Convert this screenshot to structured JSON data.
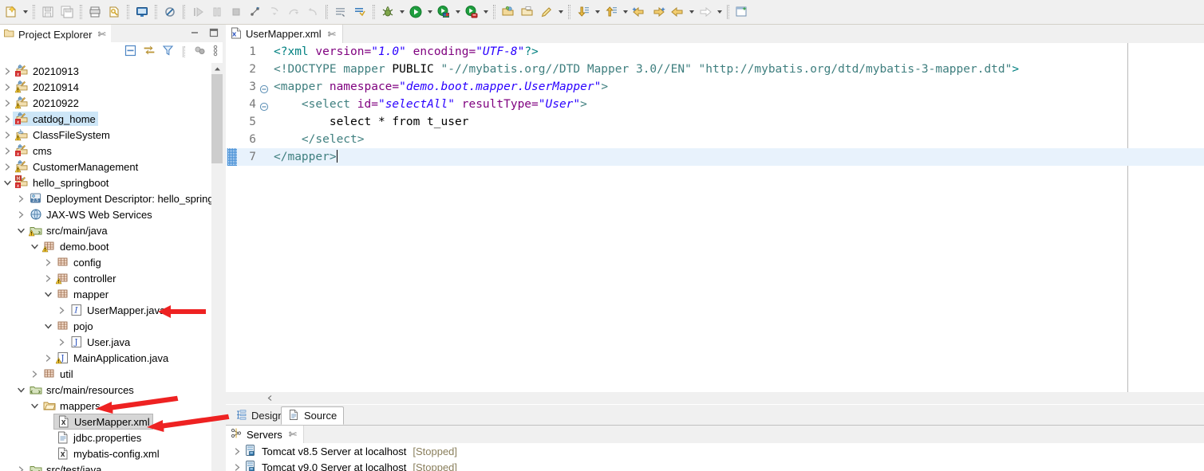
{
  "toolbar": {
    "items": [
      {
        "name": "new-wizard-icon",
        "label": "New",
        "has_dropdown": true
      },
      {
        "name": "save-icon",
        "label": "Save",
        "has_dropdown": false
      },
      {
        "name": "save-all-icon",
        "label": "Save All",
        "has_dropdown": false
      },
      {
        "name": "print-icon",
        "label": "Print",
        "has_dropdown": false
      },
      {
        "name": "link-resource-icon",
        "label": "Link",
        "has_dropdown": false
      },
      {
        "name": "console-icon",
        "label": "Console",
        "has_dropdown": false
      },
      {
        "name": "no-marker-icon",
        "label": "Skip All Breakpoints",
        "has_dropdown": false
      },
      {
        "name": "resume-icon",
        "label": "Resume",
        "has_dropdown": false
      },
      {
        "name": "suspend-icon",
        "label": "Suspend",
        "has_dropdown": false
      },
      {
        "name": "terminate-icon",
        "label": "Terminate",
        "has_dropdown": false
      },
      {
        "name": "disconnect-icon",
        "label": "Disconnect",
        "has_dropdown": false
      },
      {
        "name": "step-into-icon",
        "label": "Step Into",
        "has_dropdown": false
      },
      {
        "name": "step-over-icon",
        "label": "Step Over",
        "has_dropdown": false
      },
      {
        "name": "step-return-icon",
        "label": "Step Return",
        "has_dropdown": false
      },
      {
        "name": "open-task-icon",
        "label": "Open Task",
        "has_dropdown": false
      },
      {
        "name": "new-java-class-icon",
        "label": "New Java Class",
        "has_dropdown": false
      },
      {
        "name": "debug-icon",
        "label": "Debug",
        "has_dropdown": true
      },
      {
        "name": "run-icon",
        "label": "Run",
        "has_dropdown": true
      },
      {
        "name": "run-on-server-icon",
        "label": "Run on Server",
        "has_dropdown": true
      },
      {
        "name": "profile-icon",
        "label": "Profile",
        "has_dropdown": true
      },
      {
        "name": "open-type-icon",
        "label": "Open Type",
        "has_dropdown": false
      },
      {
        "name": "open-resource-icon",
        "label": "Open Resource",
        "has_dropdown": false
      },
      {
        "name": "quick-access-icon",
        "label": "Search",
        "has_dropdown": true
      },
      {
        "name": "previous-annotation-icon",
        "label": "Previous Annotation",
        "has_dropdown": true
      },
      {
        "name": "next-annotation-icon",
        "label": "Next Annotation",
        "has_dropdown": true
      },
      {
        "name": "back-edit-icon",
        "label": "Last Edit Location",
        "has_dropdown": false
      },
      {
        "name": "forward-edit-icon",
        "label": "Next Edit Location",
        "has_dropdown": false
      },
      {
        "name": "back-icon",
        "label": "Back",
        "has_dropdown": true
      },
      {
        "name": "forward-icon",
        "label": "Forward",
        "has_dropdown": true
      },
      {
        "name": "new-window-icon",
        "label": "New Window",
        "has_dropdown": false
      }
    ]
  },
  "explorer": {
    "tab_title": "Project Explorer",
    "tab_close_glyph": "✄",
    "window_buttons": [
      {
        "name": "minimize-view-button",
        "glyph": "—"
      },
      {
        "name": "maximize-view-button",
        "glyph": "❐"
      }
    ],
    "view_toolbar": [
      {
        "name": "collapse-all-icon",
        "label": "Collapse All"
      },
      {
        "name": "link-with-editor-icon",
        "label": "Link with Editor"
      },
      {
        "name": "filter-icon",
        "label": "Filters"
      },
      {
        "name": "view-layout-icon",
        "label": "View Layout"
      },
      {
        "name": "view-menu-icon",
        "label": "View Menu"
      }
    ],
    "tree": [
      {
        "label": "20210913",
        "indent": 0,
        "twist": "collapsed",
        "icon": "web-project-error-icon",
        "selected": "none"
      },
      {
        "label": "20210914",
        "indent": 0,
        "twist": "collapsed",
        "icon": "web-project-warning-icon",
        "selected": "none"
      },
      {
        "label": "20210922",
        "indent": 0,
        "twist": "collapsed",
        "icon": "web-project-warning-icon",
        "selected": "none"
      },
      {
        "label": "catdog_home",
        "indent": 0,
        "twist": "collapsed",
        "icon": "web-project-error-icon",
        "selected": "blue"
      },
      {
        "label": "ClassFileSystem",
        "indent": 0,
        "twist": "collapsed",
        "icon": "java-project-warning-icon",
        "selected": "none"
      },
      {
        "label": "cms",
        "indent": 0,
        "twist": "collapsed",
        "icon": "web-project-error-icon",
        "selected": "none"
      },
      {
        "label": "CustomerManagement",
        "indent": 0,
        "twist": "collapsed",
        "icon": "web-project-warning-icon",
        "selected": "none"
      },
      {
        "label": "hello_springboot",
        "indent": 0,
        "twist": "expanded",
        "icon": "maven-project-error-icon",
        "selected": "none"
      },
      {
        "label": "Deployment Descriptor: hello_springb",
        "indent": 1,
        "twist": "collapsed",
        "icon": "deployment-descriptor-icon",
        "selected": "none"
      },
      {
        "label": "JAX-WS Web Services",
        "indent": 1,
        "twist": "collapsed",
        "icon": "jaxws-icon",
        "selected": "none"
      },
      {
        "label": "src/main/java",
        "indent": 1,
        "twist": "expanded",
        "icon": "source-folder-warning-icon",
        "selected": "none"
      },
      {
        "label": "demo.boot",
        "indent": 2,
        "twist": "expanded",
        "icon": "package-warning-icon",
        "selected": "none"
      },
      {
        "label": "config",
        "indent": 3,
        "twist": "collapsed",
        "icon": "package-icon",
        "selected": "none"
      },
      {
        "label": "controller",
        "indent": 3,
        "twist": "collapsed",
        "icon": "package-warning-icon",
        "selected": "none"
      },
      {
        "label": "mapper",
        "indent": 3,
        "twist": "expanded",
        "icon": "package-icon",
        "selected": "none"
      },
      {
        "label": "UserMapper.java",
        "indent": 4,
        "twist": "collapsed",
        "icon": "java-interface-icon",
        "selected": "none"
      },
      {
        "label": "pojo",
        "indent": 3,
        "twist": "expanded",
        "icon": "package-icon",
        "selected": "none"
      },
      {
        "label": "User.java",
        "indent": 4,
        "twist": "collapsed",
        "icon": "java-class-icon",
        "selected": "none"
      },
      {
        "label": "MainApplication.java",
        "indent": 3,
        "twist": "collapsed",
        "icon": "java-class-warning-icon",
        "selected": "none"
      },
      {
        "label": "util",
        "indent": 2,
        "twist": "collapsed",
        "icon": "package-icon",
        "selected": "none"
      },
      {
        "label": "src/main/resources",
        "indent": 1,
        "twist": "expanded",
        "icon": "source-folder-icon",
        "selected": "none"
      },
      {
        "label": "mappers",
        "indent": 2,
        "twist": "expanded",
        "icon": "folder-icon",
        "selected": "none"
      },
      {
        "label": "UserMapper.xml",
        "indent": 3,
        "twist": "none",
        "icon": "xml-file-icon",
        "selected": "gray"
      },
      {
        "label": "jdbc.properties",
        "indent": 3,
        "twist": "none",
        "icon": "properties-file-icon",
        "selected": "none"
      },
      {
        "label": "mybatis-config.xml",
        "indent": 3,
        "twist": "none",
        "icon": "xml-file-icon",
        "selected": "none"
      },
      {
        "label": "src/test/java",
        "indent": 1,
        "twist": "collapsed",
        "icon": "source-folder-icon",
        "selected": "none"
      }
    ]
  },
  "editor": {
    "tab": {
      "title": "UserMapper.xml",
      "icon": "xml-file-icon",
      "close_glyph": "✄"
    },
    "print_margin_x": 1130,
    "current_line": 7,
    "lines": [
      {
        "num": "1",
        "fold": "none",
        "changed": false,
        "current": false,
        "tokens": [
          {
            "t": "<?xml ",
            "c": "x-punct"
          },
          {
            "t": "version=",
            "c": "x-attr"
          },
          {
            "t": "\"1.0\"",
            "c": "x-val"
          },
          {
            "t": " ",
            "c": "x-plain"
          },
          {
            "t": "encoding=",
            "c": "x-attr"
          },
          {
            "t": "\"UTF-8\"",
            "c": "x-val"
          },
          {
            "t": "?>",
            "c": "x-punct"
          }
        ]
      },
      {
        "num": "2",
        "fold": "none",
        "changed": false,
        "current": false,
        "tokens": [
          {
            "t": "<!DOCTYPE mapper ",
            "c": "x-doctype"
          },
          {
            "t": "PUBLIC",
            "c": "x-plain"
          },
          {
            "t": " \"-//mybatis.org//DTD Mapper 3.0//EN\" \"http://mybatis.org/dtd/mybatis-3-mapper.dtd\"",
            "c": "x-dtdstr"
          },
          {
            "t": ">",
            "c": "x-punct"
          }
        ]
      },
      {
        "num": "3",
        "fold": "collapse",
        "changed": false,
        "current": false,
        "tokens": [
          {
            "t": "<mapper ",
            "c": "x-tag"
          },
          {
            "t": "namespace=",
            "c": "x-attr"
          },
          {
            "t": "\"demo.boot.mapper.UserMapper\"",
            "c": "x-val"
          },
          {
            "t": ">",
            "c": "x-tag"
          }
        ]
      },
      {
        "num": "4",
        "fold": "collapse",
        "changed": false,
        "current": false,
        "tokens": [
          {
            "t": "    <select ",
            "c": "x-tag"
          },
          {
            "t": "id=",
            "c": "x-attr"
          },
          {
            "t": "\"selectAll\"",
            "c": "x-val"
          },
          {
            "t": " ",
            "c": "x-plain"
          },
          {
            "t": "resultType=",
            "c": "x-attr"
          },
          {
            "t": "\"User\"",
            "c": "x-val"
          },
          {
            "t": ">",
            "c": "x-tag"
          }
        ]
      },
      {
        "num": "5",
        "fold": "none",
        "changed": false,
        "current": false,
        "tokens": [
          {
            "t": "        select * from t_user",
            "c": "x-plain"
          }
        ]
      },
      {
        "num": "6",
        "fold": "none",
        "changed": false,
        "current": false,
        "tokens": [
          {
            "t": "    </select>",
            "c": "x-tag"
          }
        ]
      },
      {
        "num": "7",
        "fold": "none",
        "changed": true,
        "current": true,
        "tokens": [
          {
            "t": "</mapper>",
            "c": "x-tag"
          }
        ]
      }
    ]
  },
  "bottom_tabs": {
    "items": [
      {
        "label": "Design",
        "icon": "design-tree-icon",
        "active": false
      },
      {
        "label": "Source",
        "icon": "source-file-icon",
        "active": true
      }
    ]
  },
  "servers": {
    "tab_title": "Servers",
    "tab_icon": "servers-icon",
    "tab_close_glyph": "✄",
    "rows": [
      {
        "name": "Tomcat v8.5 Server at localhost",
        "state": "[Stopped]",
        "icon": "server-icon",
        "twist": "collapsed"
      },
      {
        "name": "Tomcat v9.0 Server at localhost",
        "state": "[Stopped]",
        "icon": "server-icon",
        "twist": "collapsed"
      }
    ]
  },
  "annotations": {
    "color": "#ee2222",
    "arrows": [
      {
        "name": "arrow-to-usermapper-java",
        "target": "UserMapper.java"
      },
      {
        "name": "arrow-to-mappers-folder",
        "target": "mappers"
      },
      {
        "name": "arrow-to-usermapper-xml",
        "target": "UserMapper.xml"
      }
    ]
  }
}
